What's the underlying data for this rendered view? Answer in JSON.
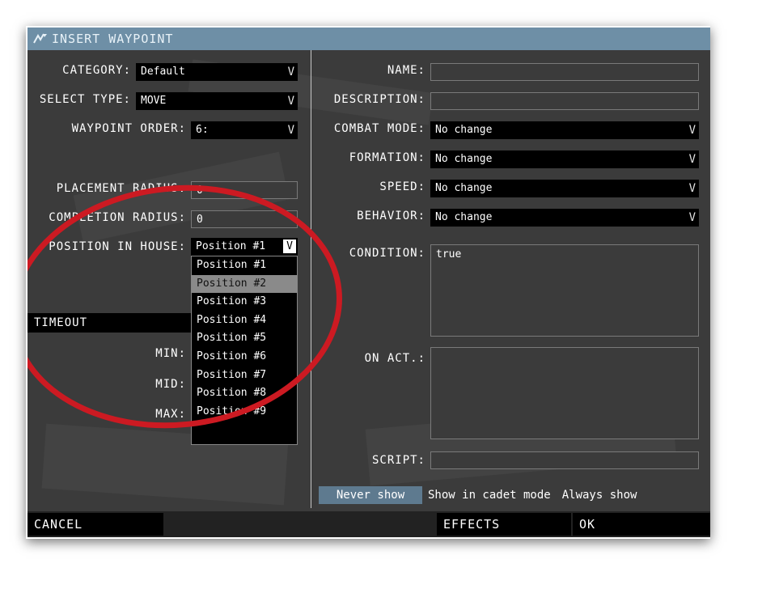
{
  "window": {
    "title": "INSERT WAYPOINT",
    "icon": "waypoint-icon"
  },
  "left": {
    "category": {
      "label": "CATEGORY:",
      "value": "Default"
    },
    "select_type": {
      "label": "SELECT TYPE:",
      "value": "MOVE"
    },
    "waypoint_order": {
      "label": "WAYPOINT ORDER:",
      "value": "6:"
    },
    "placement_radius": {
      "label": "PLACEMENT RADIUS:",
      "value": "0"
    },
    "completion_radius": {
      "label": "COMPLETION RADIUS:",
      "value": "0"
    },
    "position_in_house": {
      "label": "POSITION IN HOUSE:",
      "value": "Position #1",
      "options": [
        "Position #1",
        "Position #2",
        "Position #3",
        "Position #4",
        "Position #5",
        "Position #6",
        "Position #7",
        "Position #8",
        "Position #9"
      ],
      "highlighted_index": 1
    },
    "timeout": {
      "label": "TIMEOUT",
      "min_label": "MIN:",
      "mid_label": "MID:",
      "max_label": "MAX:"
    }
  },
  "right": {
    "name": {
      "label": "NAME:",
      "value": ""
    },
    "description": {
      "label": "DESCRIPTION:",
      "value": ""
    },
    "combat_mode": {
      "label": "COMBAT MODE:",
      "value": "No change"
    },
    "formation": {
      "label": "FORMATION:",
      "value": "No change"
    },
    "speed": {
      "label": "SPEED:",
      "value": "No change"
    },
    "behavior": {
      "label": "BEHAVIOR:",
      "value": "No change"
    },
    "condition": {
      "label": "CONDITION:",
      "value": "true"
    },
    "on_act": {
      "label": "ON ACT.:",
      "value": ""
    },
    "script": {
      "label": "SCRIPT:",
      "value": ""
    },
    "visibility": {
      "never": "Never show",
      "cadet": "Show in cadet mode",
      "always": "Always show",
      "selected": "Never show"
    }
  },
  "buttons": {
    "cancel": "CANCEL",
    "effects": "EFFECTS",
    "ok": "OK"
  },
  "dropdown_caret": "V",
  "colors": {
    "titlebar": "#6e8fa6",
    "panel": "#3b3b3b",
    "annotation_ring": "#cc1a22",
    "selected_toggle": "#5e7a8f"
  }
}
